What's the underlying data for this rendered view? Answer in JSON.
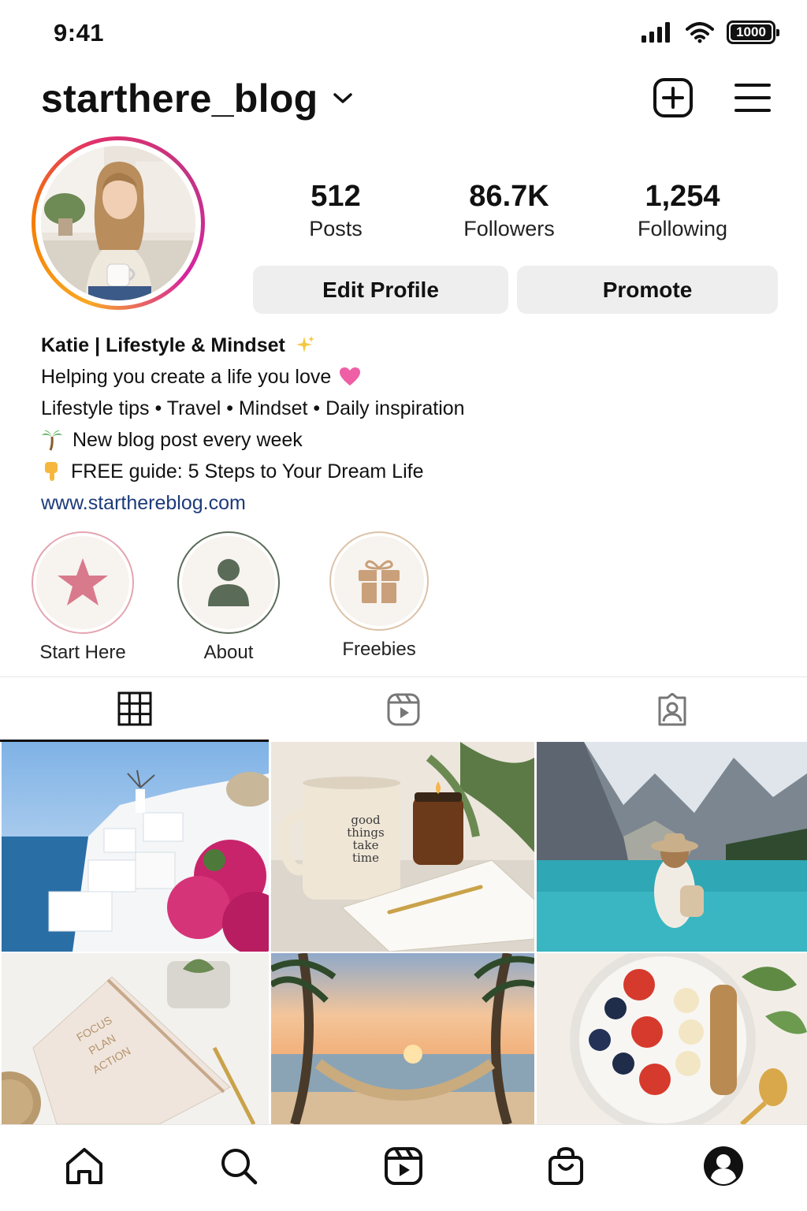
{
  "status_bar": {
    "time": "9:41",
    "battery": "1000"
  },
  "header": {
    "username": "starthere_blog"
  },
  "profile": {
    "stats": [
      {
        "value": "512",
        "label": "Posts"
      },
      {
        "value": "86.7K",
        "label": "Followers"
      },
      {
        "value": "1,254",
        "label": "Following"
      }
    ],
    "buttons": {
      "edit": "Edit Profile",
      "promote": "Promote"
    },
    "bio": {
      "name": "Katie | Lifestyle & Mindset",
      "line1": "Helping you create a life you love",
      "line2": "Lifestyle tips • Travel • Mindset • Daily inspiration",
      "line3": "New blog post every week",
      "line4": "FREE guide: 5 Steps to Your Dream Life",
      "link": "www.starthereblog.com"
    }
  },
  "highlights": [
    {
      "label": "Start Here",
      "icon": "star-icon",
      "color": "#d97a8c"
    },
    {
      "label": "About",
      "icon": "person-icon",
      "color": "#5a6b58"
    },
    {
      "label": "Freebies",
      "icon": "gift-icon",
      "color": "#c9a07a"
    }
  ],
  "tabs": [
    {
      "icon": "grid-icon",
      "active": true
    },
    {
      "icon": "reels-icon",
      "active": false
    },
    {
      "icon": "tagged-icon",
      "active": false
    }
  ],
  "posts": {
    "mug_text": [
      "good",
      "things",
      "take",
      "time"
    ],
    "notebook_text": [
      "FOCUS",
      "PLAN",
      "ACTION"
    ]
  },
  "bottom_nav": [
    {
      "icon": "home-icon"
    },
    {
      "icon": "search-icon"
    },
    {
      "icon": "reels-icon"
    },
    {
      "icon": "shop-icon"
    },
    {
      "icon": "profile-icon"
    }
  ],
  "colors": {
    "link": "#1d3b7a",
    "button_bg": "#eeeeef"
  }
}
